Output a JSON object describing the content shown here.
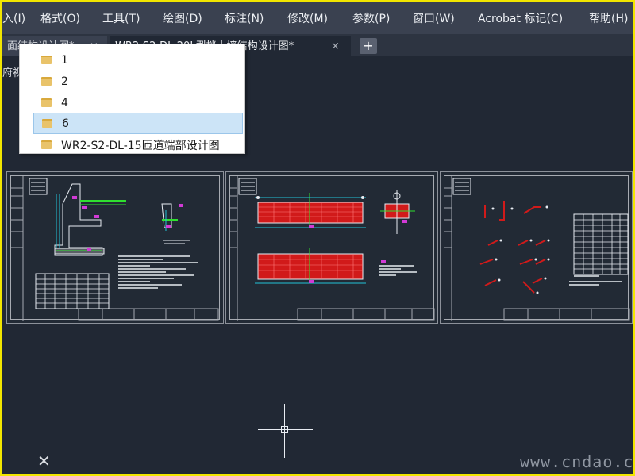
{
  "menu": {
    "items": [
      {
        "label": "入(I)"
      },
      {
        "label": "格式(O)"
      },
      {
        "label": "工具(T)"
      },
      {
        "label": "绘图(D)"
      },
      {
        "label": "标注(N)"
      },
      {
        "label": "修改(M)"
      },
      {
        "label": "参数(P)"
      },
      {
        "label": "窗口(W)"
      },
      {
        "label": "Acrobat 标记(C)"
      },
      {
        "label": "帮助(H)"
      }
    ]
  },
  "tabs": [
    {
      "label": "面结构设计图*",
      "active": false
    },
    {
      "label": "WR2-S2-DL-20L型挡土墙结构设计图*",
      "active": true
    }
  ],
  "new_tab_label": "+",
  "close_glyph": "×",
  "viewport_label": "府视",
  "dropdown": {
    "items": [
      {
        "label": "1",
        "selected": false
      },
      {
        "label": "2",
        "selected": false
      },
      {
        "label": "4",
        "selected": false
      },
      {
        "label": "6",
        "selected": true
      },
      {
        "label": "WR2-S2-DL-15匝道端部设计图",
        "selected": false
      }
    ]
  },
  "ucs_glyph": "✕",
  "watermark": "www.cndao.com",
  "colors": {
    "border_highlight": "#f2e600",
    "canvas_background": "#212834",
    "menubar_background": "#3a4150",
    "selection": "#cce4f7",
    "drawing_red": "#d11a1a",
    "drawing_magenta": "#d23ad6",
    "drawing_green": "#2fe02f",
    "drawing_cyan": "#22c3d8"
  }
}
